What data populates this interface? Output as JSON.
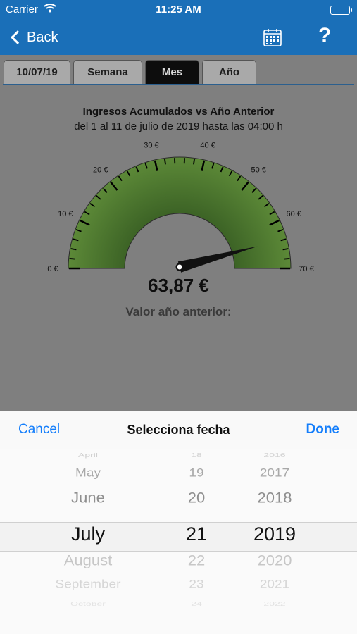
{
  "status": {
    "carrier": "Carrier",
    "time": "11:25 AM"
  },
  "nav": {
    "back_label": "Back",
    "help_label": "?"
  },
  "tabs": [
    {
      "label": "10/07/19",
      "active": false
    },
    {
      "label": "Semana",
      "active": false
    },
    {
      "label": "Mes",
      "active": true
    },
    {
      "label": "Año",
      "active": false
    }
  ],
  "chart": {
    "title": "Ingresos Acumulados vs Año Anterior",
    "subtitle": "del 1 al 11 de julio de 2019 hasta las 04:00 h",
    "value_display": "63,87 €",
    "previous_label": "Valor año anterior:"
  },
  "chart_data": {
    "type": "gauge",
    "min": 0,
    "max": 70,
    "value": 63.87,
    "tick_labels": [
      "0 €",
      "10 €",
      "20 €",
      "30 €",
      "40 €",
      "50 €",
      "60 €",
      "70 €"
    ],
    "fill_color": "#4e7a2e"
  },
  "picker_sheet": {
    "cancel_label": "Cancel",
    "title": "Selecciona fecha",
    "done_label": "Done",
    "months": [
      "April",
      "May",
      "June",
      "July",
      "August",
      "September",
      "October"
    ],
    "days": [
      "18",
      "19",
      "20",
      "21",
      "22",
      "23",
      "24"
    ],
    "years": [
      "2016",
      "2017",
      "2018",
      "2019",
      "2020",
      "2021",
      "2022"
    ],
    "selected": {
      "month": "July",
      "day": "21",
      "year": "2019"
    }
  },
  "colors": {
    "nav_bar": "#1a6fb8",
    "accent": "#147efb"
  }
}
